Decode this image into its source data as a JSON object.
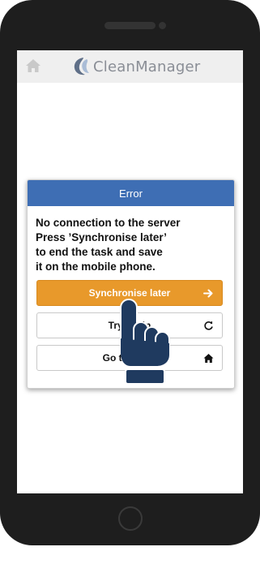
{
  "app": {
    "logo_text": "CleanManager"
  },
  "dialog": {
    "title": "Error",
    "message": "No connection to the server\nPress ’Synchronise later’\nto end the task and save\nit on the mobile phone.",
    "buttons": [
      {
        "label": "Synchronise later",
        "icon": "arrow-right-icon"
      },
      {
        "label": "Try again",
        "icon": "refresh-icon"
      },
      {
        "label": "Go to home",
        "icon": "home-icon"
      }
    ]
  },
  "colors": {
    "dialog_header": "#3e6eb4",
    "primary_button": "#e8992b",
    "hand": "#1f3a5f"
  }
}
